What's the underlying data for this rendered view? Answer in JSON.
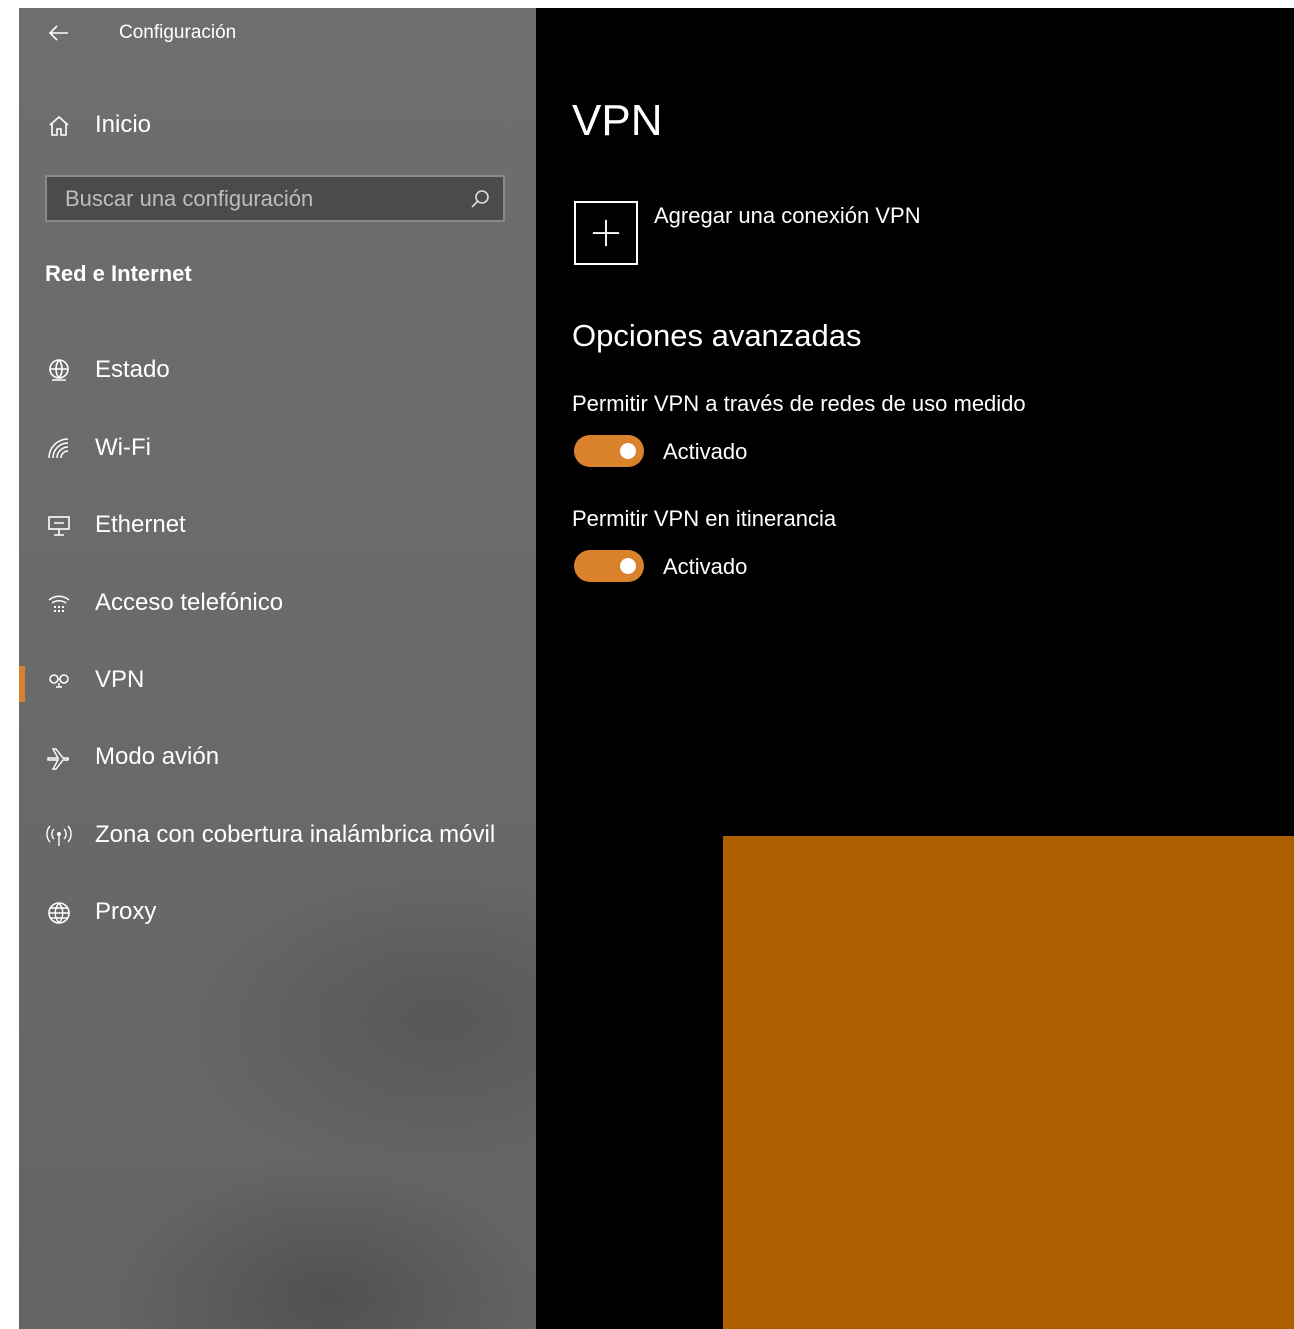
{
  "window": {
    "app_title": "Configuración"
  },
  "sidebar": {
    "home_label": "Inicio",
    "search_placeholder": "Buscar una configuración",
    "section_label": "Red e Internet",
    "items": [
      {
        "label": "Estado",
        "icon": "status-globe-icon"
      },
      {
        "label": "Wi-Fi",
        "icon": "wifi-icon"
      },
      {
        "label": "Ethernet",
        "icon": "ethernet-icon"
      },
      {
        "label": "Acceso telefónico",
        "icon": "dialup-icon"
      },
      {
        "label": "VPN",
        "icon": "vpn-icon",
        "selected": true
      },
      {
        "label": "Modo avión",
        "icon": "airplane-icon"
      },
      {
        "label": "Zona con cobertura inalámbrica móvil",
        "icon": "hotspot-icon"
      },
      {
        "label": "Proxy",
        "icon": "globe-icon"
      }
    ]
  },
  "main": {
    "title": "VPN",
    "add_vpn_label": "Agregar una conexión VPN",
    "advanced_title": "Opciones avanzadas",
    "options": [
      {
        "label": "Permitir VPN a través de redes de uso medido",
        "state": "Activado",
        "on": true
      },
      {
        "label": "Permitir VPN en itinerancia",
        "state": "Activado",
        "on": true
      }
    ]
  },
  "colors": {
    "accent": "#d9822b",
    "overlay_block": "#ad5f00",
    "sidebar_bg": "#6a6a6a",
    "content_bg": "#000000"
  }
}
